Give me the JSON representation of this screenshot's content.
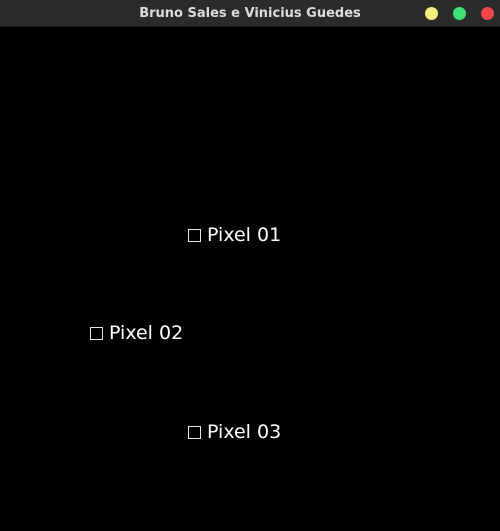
{
  "window": {
    "title": "Bruno Sales e Vinicius Guedes",
    "buttons": {
      "minimize_color": "#f4f07e",
      "maximize_color": "#3fe27a",
      "close_color": "#f04848"
    }
  },
  "pixels": [
    {
      "label": "Pixel 01",
      "icon": "square-outline-icon"
    },
    {
      "label": "Pixel 02",
      "icon": "square-outline-icon"
    },
    {
      "label": "Pixel 03",
      "icon": "square-outline-icon"
    }
  ],
  "colors": {
    "background": "#000000",
    "text": "#ffffff",
    "box_border": "#f1e4dc"
  }
}
